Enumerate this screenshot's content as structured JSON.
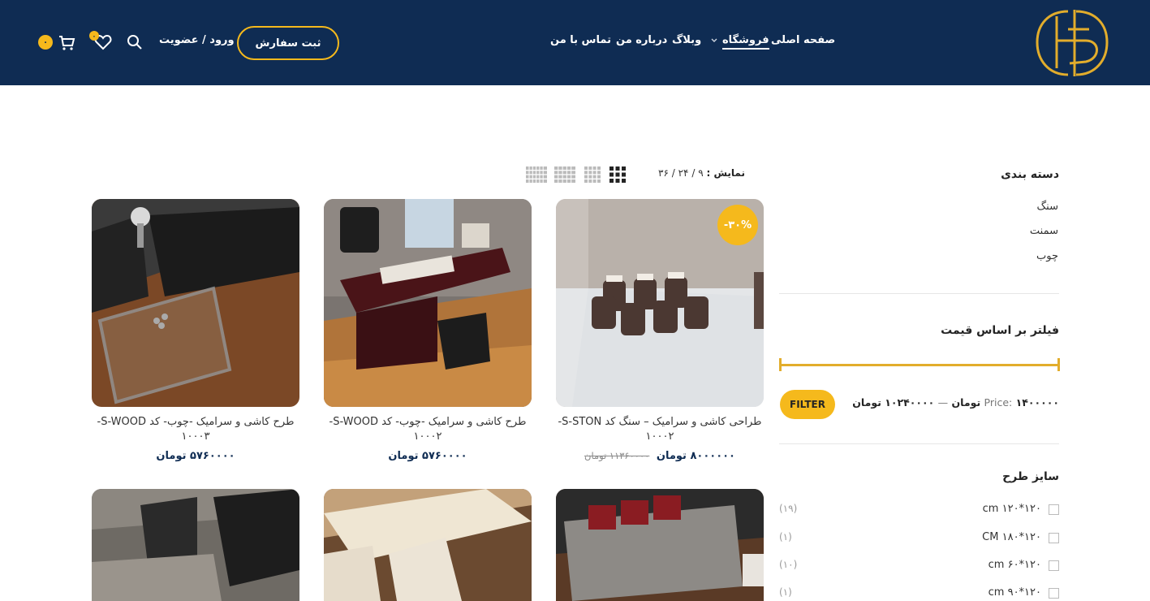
{
  "header": {
    "nav": {
      "home": "صفحه اصلی",
      "shop": "فروشگاه",
      "blog": "وبلاگ",
      "about": "درباره من",
      "contact": "تماس با من"
    },
    "order_button": "ثبت سفارش",
    "login": "ورود / عضویت",
    "wishlist_count": "۰",
    "cart_count": "۰",
    "accent_color": "#f5b91c",
    "bg_color": "#0f2c53"
  },
  "toolbar": {
    "show_label": "نمایش :",
    "per_page": {
      "a": "۹",
      "b": "۲۴",
      "c": "۳۶"
    },
    "separator": "/"
  },
  "sidebar": {
    "categories_title": "دسته بندی",
    "categories": [
      "سنگ",
      "سمنت",
      "چوب"
    ],
    "price_filter_title": "فیلتر بر اساس قیمت",
    "filter_button": "FILTER",
    "price_label": "Price:",
    "price_min": "۱۴۰۰۰۰۰",
    "price_min_unit": "تومان",
    "price_dash": "—",
    "price_max": "۱۰۲۴۰۰۰۰ تومان",
    "size_title": "سایز طرح",
    "sizes": [
      {
        "label": "cm ۱۲۰*۱۲۰",
        "count": "(۱۹)"
      },
      {
        "label": "CM ۱۸۰*۱۲۰",
        "count": "(۱)"
      },
      {
        "label": "cm ۶۰*۱۲۰",
        "count": "(۱۰)"
      },
      {
        "label": "cm ۹۰*۱۲۰",
        "count": "(۱)"
      }
    ]
  },
  "products": [
    {
      "title_line1": "طراحی کاشی و سرامیک – سنگ کد S-STON-",
      "title_line2": "۱۰۰۰۲",
      "old_price": "۱۱۳۶۰۰۰۰ تومان",
      "price": "۸۰۰۰۰۰۰ تومان",
      "sale": "-۳۰%"
    },
    {
      "title_line1": "طرح کاشی و سرامیک -چوب- کد S-WOOD-",
      "title_line2": "۱۰۰۰۲",
      "price": "۵۷۶۰۰۰۰ تومان"
    },
    {
      "title_line1": "طرح کاشی و سرامیک -چوب- کد S-WOOD-",
      "title_line2": "۱۰۰۰۳",
      "price": "۵۷۶۰۰۰۰ تومان"
    }
  ]
}
